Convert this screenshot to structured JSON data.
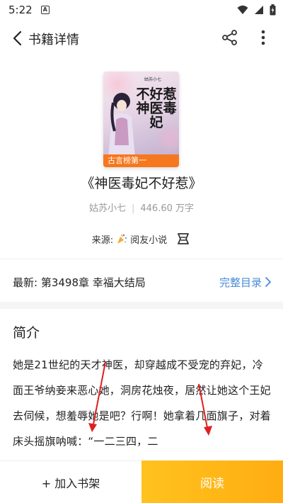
{
  "status_bar": {
    "time": "5:22",
    "app_icon_letter": "A"
  },
  "header": {
    "title": "书籍详情",
    "icons": [
      "back-arrow-icon",
      "share-icon",
      "more-vertical-icon"
    ]
  },
  "book": {
    "cover_badge": "古言榜第一",
    "cover_text": "不好惹神医毒妃",
    "cover_author": "姑苏小七",
    "title": "《神医毒妃不好惹》",
    "author": "姑苏小七",
    "separator": "|",
    "word_count": "446.60 万字",
    "source_label": "来源:",
    "source_name": "阅友小说"
  },
  "latest": {
    "label": "最新: 第3498章 幸福大结局",
    "catalog_link": "完整目录"
  },
  "intro": {
    "heading": "简介",
    "text": "她是21世纪的天才神医，却穿越成不受宠的弃妃，冷面王爷纳妾来恶心她，洞房花烛夜，居然让她这个王妃去伺候，想羞辱她是吧？行啊！她拿着几面旗子，对着床头摇旗呐喊：“一二三四，二"
  },
  "bottom": {
    "add_shelf": "+ 加入书架",
    "read": "阅读"
  },
  "colors": {
    "accent": "#ffb515",
    "link": "#4a8bd6",
    "badge": "#f5781f",
    "annotation": "#e02020"
  }
}
